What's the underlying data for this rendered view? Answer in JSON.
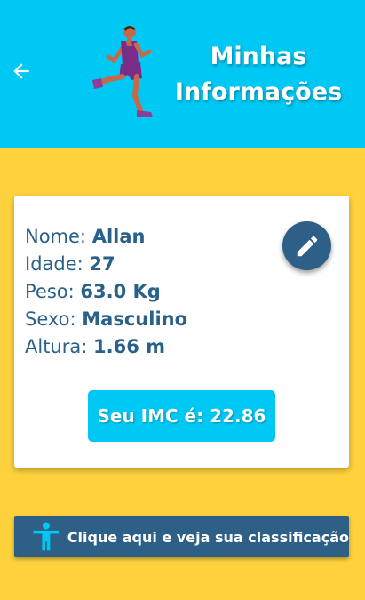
{
  "header": {
    "title_line1": "Minhas",
    "title_line2": "Informações",
    "back_icon": "arrow-left-icon",
    "image": "running-man-illustration"
  },
  "profile": {
    "rows": [
      {
        "label": "Nome:",
        "value": "Allan"
      },
      {
        "label": "Idade:",
        "value": "27"
      },
      {
        "label": "Peso:",
        "value": "63.0 Kg"
      },
      {
        "label": "Sexo:",
        "value": "Masculino"
      },
      {
        "label": "Altura:",
        "value": "1.66 m"
      }
    ],
    "edit_icon": "pencil-icon",
    "imc_label": "Seu IMC é: 22.86"
  },
  "classification_button": {
    "label": "Clique aqui e veja sua classificação",
    "icon": "accessibility-person-icon"
  },
  "colors": {
    "header": "#00c8f5",
    "background": "#ffd23d",
    "text": "#2a6189",
    "dark_button": "#2d5f87",
    "imc_button": "#00c8f5"
  }
}
